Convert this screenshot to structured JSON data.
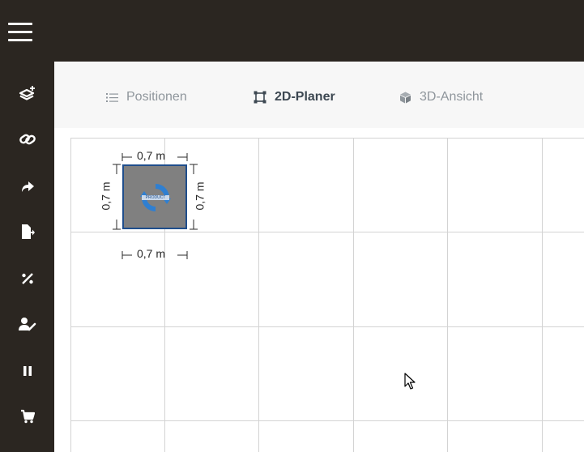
{
  "tabs": [
    {
      "label": "Positionen",
      "icon": "list-icon",
      "active": false
    },
    {
      "label": "2D-Planer",
      "icon": "frame-icon",
      "active": true
    },
    {
      "label": "3D-Ansicht",
      "icon": "cube-icon",
      "active": false
    }
  ],
  "sidebar": {
    "items": [
      {
        "icon": "layers-add-icon"
      },
      {
        "icon": "link-icon"
      },
      {
        "icon": "share-arrow-icon"
      },
      {
        "icon": "file-export-icon"
      },
      {
        "icon": "percent-icon"
      },
      {
        "icon": "user-edit-icon"
      },
      {
        "icon": "pause-icon"
      },
      {
        "icon": "cart-icon"
      }
    ]
  },
  "planner": {
    "object": {
      "width_label": "0,7 m",
      "depth_label": "0,7 m",
      "width_label_bottom": "0,7 m",
      "depth_label_right": "0,7 m",
      "logo_text": "PRODUCT"
    }
  },
  "colors": {
    "chrome": "#2b2621",
    "tab_active": "#3d4852",
    "tab_inactive": "#8f969c",
    "object_border": "#1f4e8c",
    "object_fill": "#808080",
    "grid": "#d3d3d3"
  }
}
